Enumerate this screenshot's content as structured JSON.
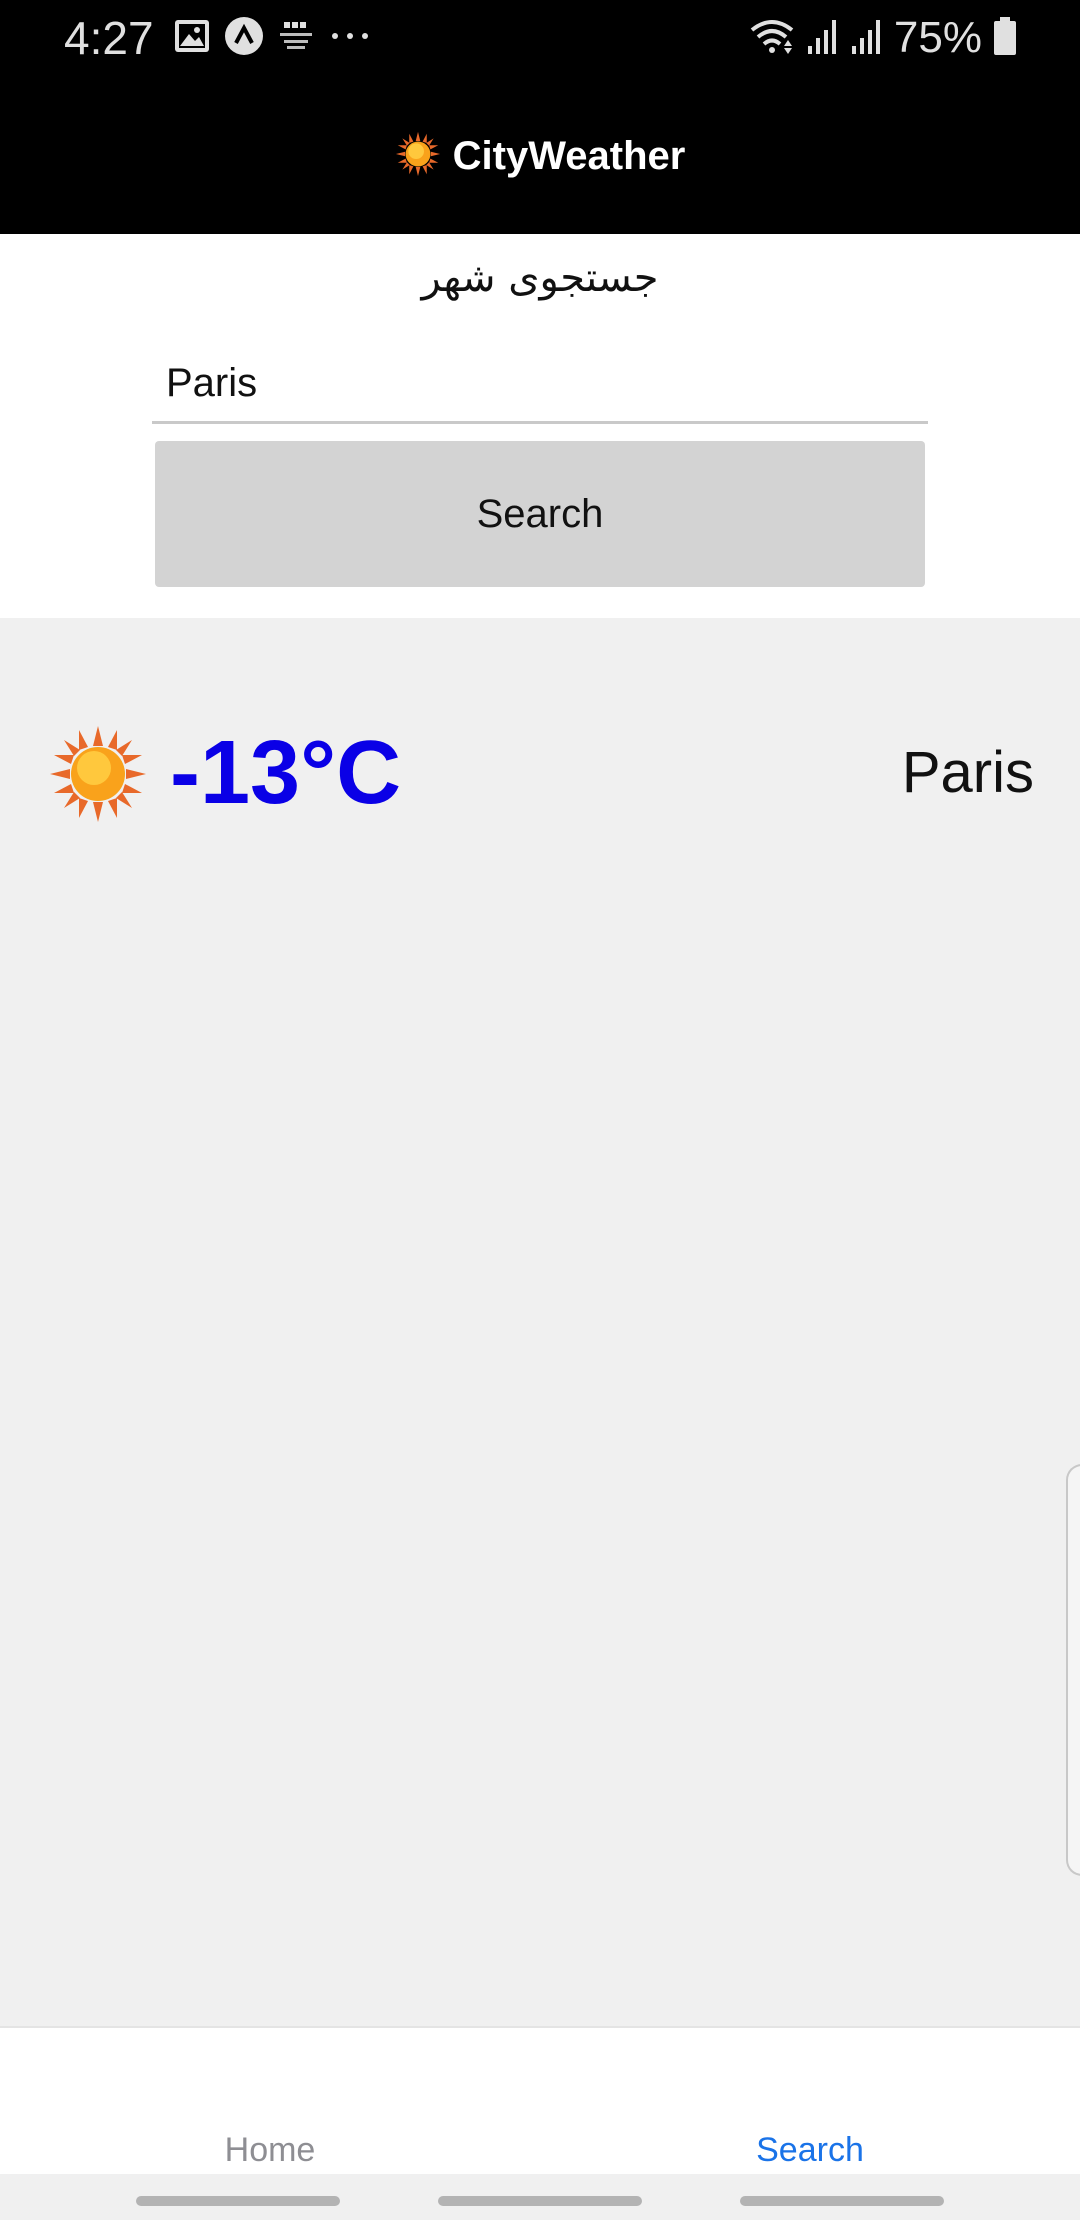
{
  "status_bar": {
    "time": "4:27",
    "battery": "75%",
    "notification_icons": [
      "image-icon",
      "a-logo-icon",
      "bbc-learning-english-icon",
      "more-dots-icon"
    ],
    "system_icons": [
      "wifi-icon",
      "signal-icon",
      "signal-icon",
      "battery-icon"
    ]
  },
  "app_bar": {
    "icon": "sun-icon",
    "title": "CityWeather"
  },
  "search": {
    "heading": "جستجوی شهر",
    "input_value": "Paris",
    "button_label": "Search"
  },
  "result": {
    "icon": "sun-icon",
    "temperature": "-13°C",
    "city": "Paris"
  },
  "tabs": {
    "home": "Home",
    "search": "Search",
    "active": "search"
  },
  "colors": {
    "app_bar_bg": "#000000",
    "temperature_text": "#0a00e6",
    "active_tab": "#1a73e8",
    "inactive_tab": "#8e8e93",
    "search_button_bg": "#d3d3d3",
    "result_bg": "#f0f0f0"
  }
}
